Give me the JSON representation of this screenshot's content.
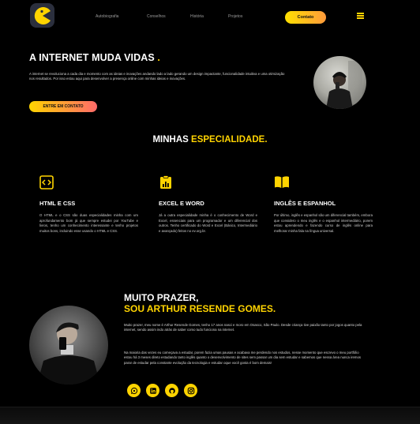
{
  "nav": {
    "logo": "pacman-logo-icon",
    "links": [
      "Autobiografia",
      "Conselhos",
      "História",
      "Projetos"
    ],
    "contact_label": "Contato",
    "menu_icon": "hamburger-menu-icon"
  },
  "hero": {
    "title": "A INTERNET MUDA VIDAS",
    "title_dot": ".",
    "text": "A internet se revoluciona a cada dia e momento com as ideias e inovações andando lado a lado gerando um design impactante, funcionalidade intuitiva e uma otimização nos resultados. Por isso estou aqui para desenvolver a presença online com minhas ideias e inovações.",
    "button_label": "ENTRE EM CONTATO"
  },
  "specialties": {
    "title_plain": "MINHAS ",
    "title_highlight": "ESPECIALIDADE.",
    "cards": [
      {
        "icon": "code-icon",
        "title": "HTML E CSS",
        "text": "O HTML e o CSS são duas especialidades minha com um aprofundamento bom já que sempre estudei por YouTube e livros, tenho um conhecimento interessante e tenho projetos muitos bons, incluindo esse usando o HTML e CSS."
      },
      {
        "icon": "clipboard-icon",
        "title": "EXCEL E WORD",
        "text": "Já a outra especialidade minha é o conhecimento de Word e Excel, essenciais para um programador e um diferencial dos outros. Tenho certificado do Word e Excel (Básico, Intermediário e avançado) feitos no ev.org.br."
      },
      {
        "icon": "book-icon",
        "title": "INGLÊS E ESPANHOL",
        "text": "Por último, inglês e espanhol são um diferencial também, embora que considero o meu inglês e o espanhol intermediário, porem estou aprendendo e fazendo curso de inglês online para melhorar minha fala na língua universal."
      }
    ]
  },
  "about": {
    "title_line1": "MUITO PRAZER,",
    "title_line2": "SOU ARTHUR RESENDE GOMES.",
    "paragraph1": "Muito prazer, meu nome é Arthur Resende Gomes, tenho 17 anos nasci e moro em Osasco, São Paulo. Desde criança tive paixão tanto por jogos quanto pela internet, sendo assim indo atrás de saber como tudo funciona na internet.",
    "paragraph2": "Na maioria das vezes eu começava a estudar, porem fazia umas pausas e acabava me perdendo nos estudos, nesse momento que escrevo o meu portfólio estou há 3 meses direto estudando tanto inglês quanto o desenvolvimento de sites sem passar um dia sem estudar e sabemos que nessa área nunca iremos parar de estudar pela constante evolução da tecnologia e estudar oque você gosta é bom demais!",
    "socials": [
      "whatsapp-icon",
      "linkedin-icon",
      "github-icon",
      "instagram-icon"
    ]
  },
  "colors": {
    "accent": "#ffd400",
    "accent_gradient_end": "#ff6a6a",
    "background": "#000000"
  }
}
